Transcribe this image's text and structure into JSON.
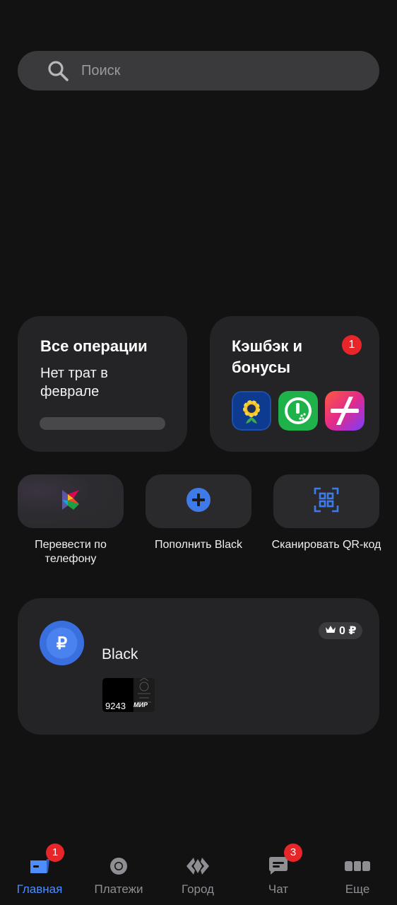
{
  "search": {
    "placeholder": "Поиск"
  },
  "operations": {
    "title": "Все операции",
    "subtitle": "Нет трат в феврале"
  },
  "cashback": {
    "title": "Кэшбэк и бонусы",
    "badge": "1",
    "partners": [
      "sunflower-logo",
      "megafon-logo",
      "plus-logo"
    ]
  },
  "quick_actions": [
    {
      "label": "Перевести по телефону",
      "icon": "sbp-icon"
    },
    {
      "label": "Пополнить Black",
      "icon": "plus-circle-icon"
    },
    {
      "label": "Сканировать QR-код",
      "icon": "qr-scan-icon"
    }
  ],
  "account": {
    "name": "Black",
    "balance": "0 ₽",
    "card_last_digits": "9243",
    "card_brand": "МИР"
  },
  "bottom_nav": [
    {
      "label": "Главная",
      "icon": "home-icon",
      "badge": "1",
      "active": true
    },
    {
      "label": "Платежи",
      "icon": "payments-icon",
      "badge": "",
      "active": false
    },
    {
      "label": "Город",
      "icon": "city-icon",
      "badge": "",
      "active": false
    },
    {
      "label": "Чат",
      "icon": "chat-icon",
      "badge": "3",
      "active": false
    },
    {
      "label": "Еще",
      "icon": "more-icon",
      "badge": "",
      "active": false
    }
  ],
  "colors": {
    "background": "#121212",
    "card": "#242426",
    "accent": "#4c8dff",
    "badge": "#e8262a"
  }
}
